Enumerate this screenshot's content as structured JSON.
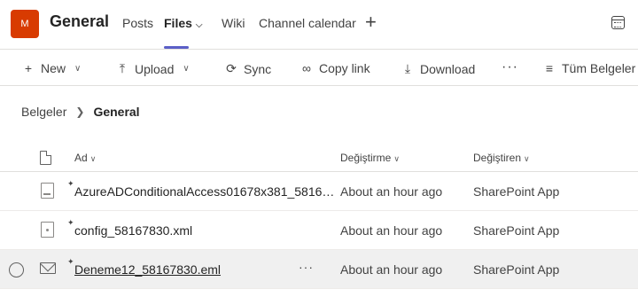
{
  "header": {
    "avatar_letter": "M",
    "team_name": "General",
    "tabs": [
      {
        "label": "Posts"
      },
      {
        "label": "Files"
      },
      {
        "label": "Wiki"
      },
      {
        "label": "Channel calendar"
      }
    ],
    "accent_color": "#5b5fc7"
  },
  "toolbar": {
    "new_label": "New",
    "upload_label": "Upload",
    "sync_label": "Sync",
    "copy_link_label": "Copy link",
    "download_label": "Download",
    "more_label": "···",
    "view_label": "Tüm Belgeler"
  },
  "breadcrumb": {
    "root": "Belgeler",
    "current": "General"
  },
  "table": {
    "columns": {
      "name": "Ad",
      "modified": "Değiştirme",
      "modified_by": "Değiştiren"
    },
    "rows": [
      {
        "name": "AzureADConditionalAccess01678x381_5816…",
        "modified": "About an hour ago",
        "modified_by": "SharePoint App",
        "icon": "image-file-icon"
      },
      {
        "name": "config_58167830.xml",
        "modified": "About an hour ago",
        "modified_by": "SharePoint App",
        "icon": "xml-file-icon"
      },
      {
        "name": "Deneme12_58167830.eml",
        "modified": "About an hour ago",
        "modified_by": "SharePoint App",
        "icon": "mail-icon"
      }
    ],
    "row_more_label": "···"
  }
}
